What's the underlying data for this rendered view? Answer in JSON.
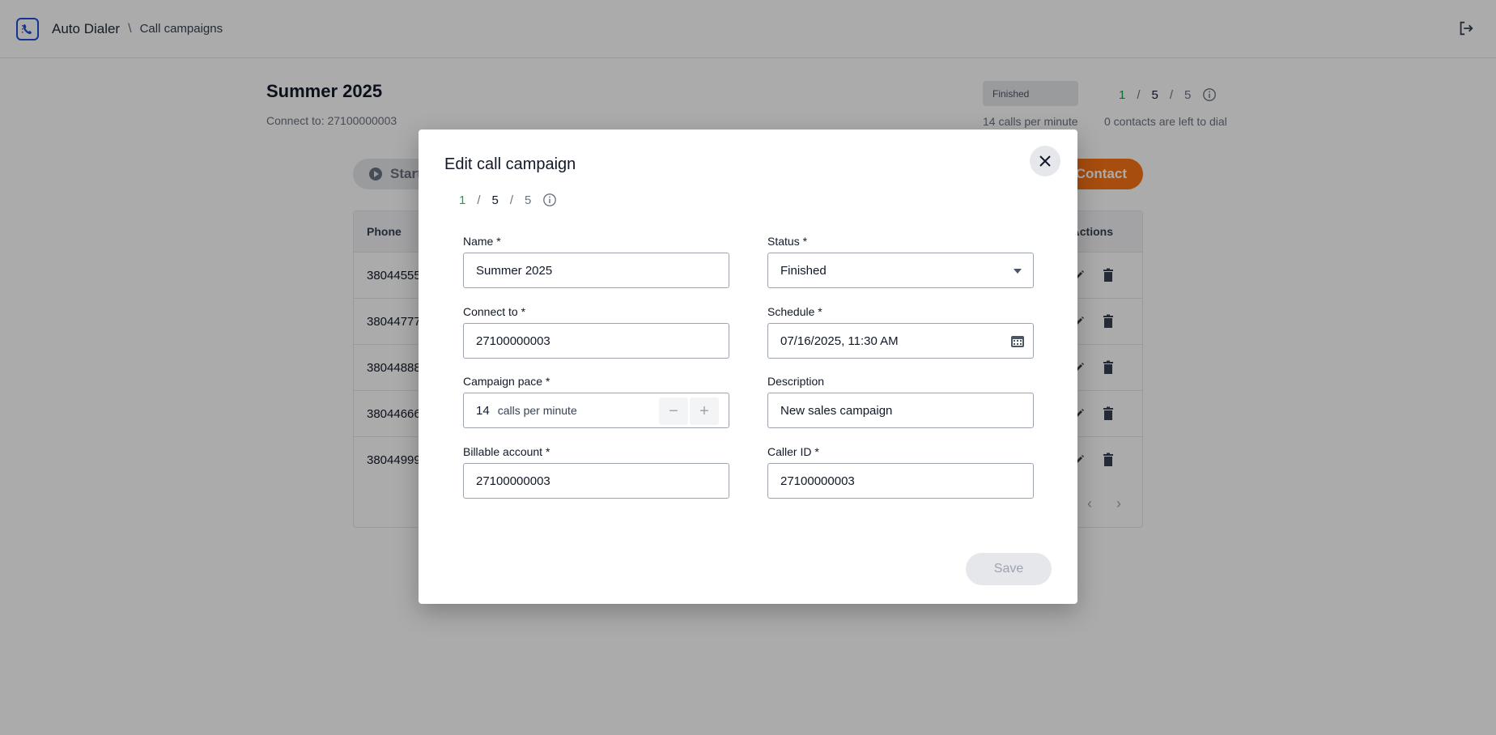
{
  "header": {
    "app_title": "Auto Dialer",
    "breadcrumb_sep": "\\",
    "breadcrumb": "Call campaigns"
  },
  "campaign": {
    "title": "Summer 2025",
    "connect_to": "Connect to: 27100000003",
    "status": "Finished",
    "pace": "14 calls per minute",
    "counter_done": "1",
    "counter_total": "5",
    "counter_all": "5",
    "counter_sep": "/",
    "left_to_dial": "0 contacts are left to dial"
  },
  "toolbar": {
    "start_label": "Start",
    "add_contact_label": "Contact"
  },
  "table": {
    "phone_header": "Phone",
    "actions_header": "Actions",
    "rows": [
      "38044555",
      "38044777",
      "38044888",
      "38044666",
      "38044999"
    ],
    "prev": "‹",
    "next": "›"
  },
  "modal": {
    "title": "Edit call campaign",
    "counter_done": "1",
    "counter_total": "5",
    "counter_all": "5",
    "counter_sep": "/",
    "name_label": "Name *",
    "name_value": "Summer 2025",
    "status_label": "Status *",
    "status_value": "Finished",
    "connect_label": "Connect to *",
    "connect_value": "27100000003",
    "schedule_label": "Schedule *",
    "schedule_value": "07/16/2025, 11:30 AM",
    "pace_label": "Campaign pace *",
    "pace_value": "14",
    "pace_unit": "calls per minute",
    "minus": "−",
    "plus": "+",
    "description_label": "Description",
    "description_value": "New sales campaign",
    "billable_label": "Billable account *",
    "billable_value": "27100000003",
    "callerid_label": "Caller ID *",
    "callerid_value": "27100000003",
    "save_label": "Save"
  },
  "colors": {
    "accent_orange": "#f97316",
    "brand_blue": "#1d4ed8",
    "counter_green": "#16a34a"
  },
  "icons": {
    "logo": "phone-logo-icon",
    "logout": "logout-icon",
    "close": "close-icon",
    "info": "info-icon",
    "calendar": "calendar-icon",
    "edit": "pencil-icon",
    "delete": "trash-icon"
  }
}
